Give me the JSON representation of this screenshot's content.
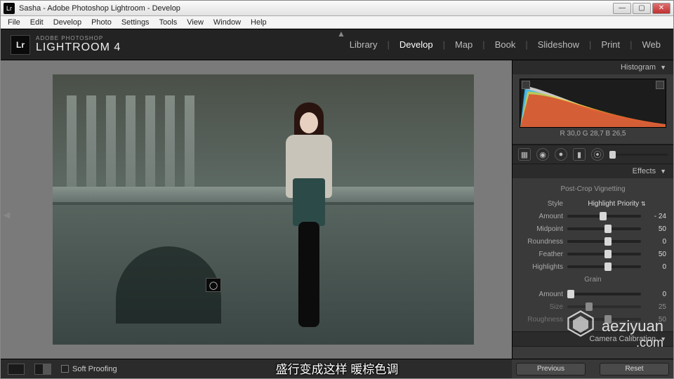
{
  "window": {
    "title": "Sasha - Adobe Photoshop Lightroom - Develop",
    "logo_abbrev": "Lr"
  },
  "menubar": [
    "File",
    "Edit",
    "Develop",
    "Photo",
    "Settings",
    "Tools",
    "View",
    "Window",
    "Help"
  ],
  "branding": {
    "line1": "ADOBE PHOTOSHOP",
    "line2": "LIGHTROOM 4"
  },
  "modules": {
    "items": [
      "Library",
      "Develop",
      "Map",
      "Book",
      "Slideshow",
      "Print",
      "Web"
    ],
    "active": "Develop"
  },
  "bottombar": {
    "soft_proofing": "Soft Proofing"
  },
  "actions": {
    "previous": "Previous",
    "reset": "Reset"
  },
  "histogram": {
    "title": "Histogram",
    "readout": "R  30,0   G  28,7   B  26,5"
  },
  "effects": {
    "title": "Effects",
    "vignette_header": "Post-Crop Vignetting",
    "style_label": "Style",
    "style_value": "Highlight Priority",
    "sliders": [
      {
        "label": "Amount",
        "value": "- 24",
        "pos": 44
      },
      {
        "label": "Midpoint",
        "value": "50",
        "pos": 50
      },
      {
        "label": "Roundness",
        "value": "0",
        "pos": 50
      },
      {
        "label": "Feather",
        "value": "50",
        "pos": 50
      },
      {
        "label": "Highlights",
        "value": "0",
        "pos": 50
      }
    ],
    "grain_header": "Grain",
    "grain": [
      {
        "label": "Amount",
        "value": "0",
        "pos": 0
      },
      {
        "label": "Size",
        "value": "25",
        "pos": 25
      },
      {
        "label": "Roughness",
        "value": "50",
        "pos": 50
      }
    ]
  },
  "calibration": {
    "title": "Camera Calibration"
  },
  "subtitle": "盛行变成这样 暖棕色调",
  "watermark": {
    "line1": "aeziyuan",
    "line2": ".com"
  }
}
